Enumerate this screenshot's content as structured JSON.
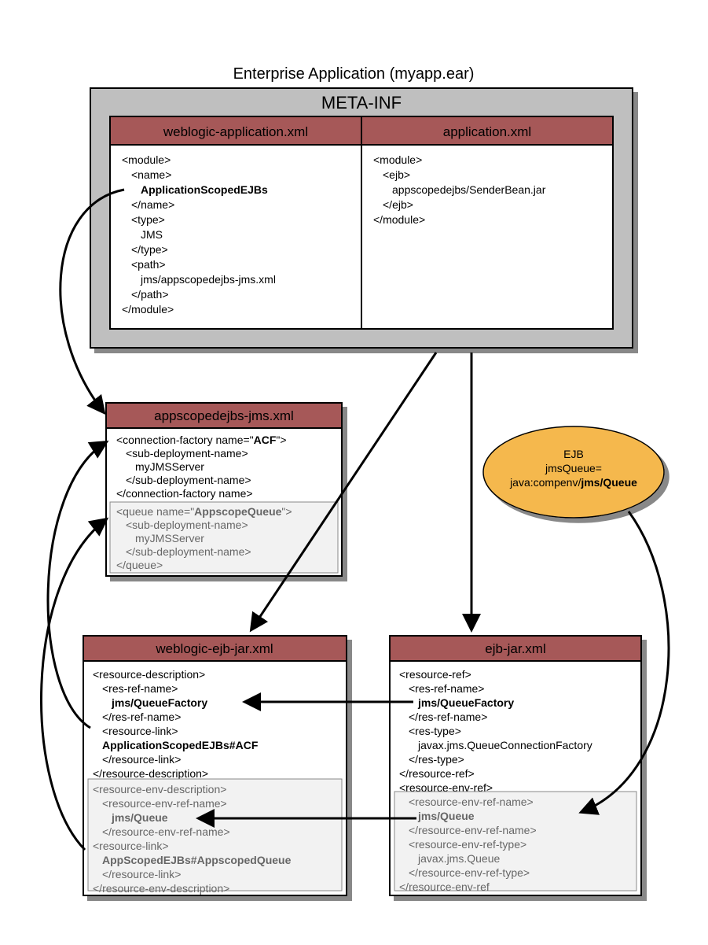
{
  "title": "Enterprise Application (myapp.ear)",
  "metainf": {
    "label": "META-INF",
    "left": {
      "header": "weblogic-application.xml",
      "lines": [
        {
          "t": "<module>",
          "indent": 0
        },
        {
          "t": "<name>",
          "indent": 1
        },
        {
          "t": "ApplicationScopedEJBs",
          "indent": 2,
          "bold": true
        },
        {
          "t": "</name>",
          "indent": 1
        },
        {
          "t": "<type>",
          "indent": 1
        },
        {
          "t": "JMS",
          "indent": 2
        },
        {
          "t": "</type>",
          "indent": 1
        },
        {
          "t": "<path>",
          "indent": 1
        },
        {
          "t": "jms/appscopedejbs-jms.xml",
          "indent": 2
        },
        {
          "t": "</path>",
          "indent": 1
        },
        {
          "t": "</module>",
          "indent": 0
        }
      ]
    },
    "right": {
      "header": "application.xml",
      "lines": [
        {
          "t": "<module>",
          "indent": 0
        },
        {
          "t": "<ejb>",
          "indent": 1
        },
        {
          "t": "appscopedejbs/SenderBean.jar",
          "indent": 2
        },
        {
          "t": "</ejb>",
          "indent": 1
        },
        {
          "t": "</module>",
          "indent": 0
        }
      ]
    }
  },
  "jmsxml": {
    "header": "appscopedejbs-jms.xml",
    "top_lines": [
      {
        "pfx": "<connection-factory name=\"",
        "bold": "ACF",
        "sfx": "\">",
        "indent": 0
      },
      {
        "t": "<sub-deployment-name>",
        "indent": 1
      },
      {
        "t": "myJMSServer",
        "indent": 2
      },
      {
        "t": "</sub-deployment-name>",
        "indent": 1
      },
      {
        "t": "</connection-factory name>",
        "indent": 0
      }
    ],
    "gray_lines": [
      {
        "pfx": "<queue name=\"",
        "bold": "AppscopeQueue",
        "sfx": "\">",
        "indent": 0
      },
      {
        "t": "<sub-deployment-name>",
        "indent": 1
      },
      {
        "t": "myJMSServer",
        "indent": 2
      },
      {
        "t": "</sub-deployment-name>",
        "indent": 1
      },
      {
        "t": "</queue>",
        "indent": 0
      }
    ]
  },
  "ejb": {
    "title": "EJB",
    "line1": "jmsQueue=",
    "line2a": "java:compenv/",
    "line2b": "jms/Queue"
  },
  "wlejb": {
    "header": "weblogic-ejb-jar.xml",
    "top_lines": [
      {
        "t": "<resource-description>",
        "indent": 0
      },
      {
        "t": "<res-ref-name>",
        "indent": 1
      },
      {
        "t": "jms/QueueFactory",
        "indent": 2,
        "bold": true
      },
      {
        "t": "</res-ref-name>",
        "indent": 1
      },
      {
        "t": "<resource-link>",
        "indent": 1
      },
      {
        "t": "ApplicationScopedEJBs#ACF",
        "indent": 1,
        "bold": true
      },
      {
        "t": "</resource-link>",
        "indent": 1
      },
      {
        "t": "</resource-description>",
        "indent": 0
      }
    ],
    "gray_lines": [
      {
        "t": "<resource-env-description>",
        "indent": 0
      },
      {
        "t": "<resource-env-ref-name>",
        "indent": 1
      },
      {
        "t": "jms/Queue",
        "indent": 2,
        "bold": true
      },
      {
        "t": "</resource-env-ref-name>",
        "indent": 1
      },
      {
        "t": "<resource-link>",
        "indent": 0
      },
      {
        "t": "AppScopedEJBs#AppscopedQueue",
        "indent": 1,
        "bold": true
      },
      {
        "t": "</resource-link>",
        "indent": 1
      },
      {
        "t": "</resource-env-description>",
        "indent": 0
      }
    ]
  },
  "ejbjar": {
    "header": "ejb-jar.xml",
    "top_lines": [
      {
        "t": "<resource-ref>",
        "indent": 0
      },
      {
        "t": "<res-ref-name>",
        "indent": 1
      },
      {
        "t": "jms/QueueFactory",
        "indent": 2,
        "bold": true
      },
      {
        "t": "</res-ref-name>",
        "indent": 1
      },
      {
        "t": "<res-type>",
        "indent": 1
      },
      {
        "t": "javax.jms.QueueConnectionFactory",
        "indent": 2
      },
      {
        "t": "</res-type>",
        "indent": 1
      },
      {
        "t": "</resource-ref>",
        "indent": 0
      },
      {
        "t": "<resource-env-ref>",
        "indent": 0
      }
    ],
    "gray_lines": [
      {
        "t": "<resource-env-ref-name>",
        "indent": 1
      },
      {
        "t": "jms/Queue",
        "indent": 2,
        "bold": true
      },
      {
        "t": "</resource-env-ref-name>",
        "indent": 1
      },
      {
        "t": "<resource-env-ref-type>",
        "indent": 1
      },
      {
        "t": "javax.jms.Queue",
        "indent": 2
      },
      {
        "t": "</resource-env-ref-type>",
        "indent": 1
      },
      {
        "t": "</resource-env-ref",
        "indent": 0
      }
    ]
  }
}
